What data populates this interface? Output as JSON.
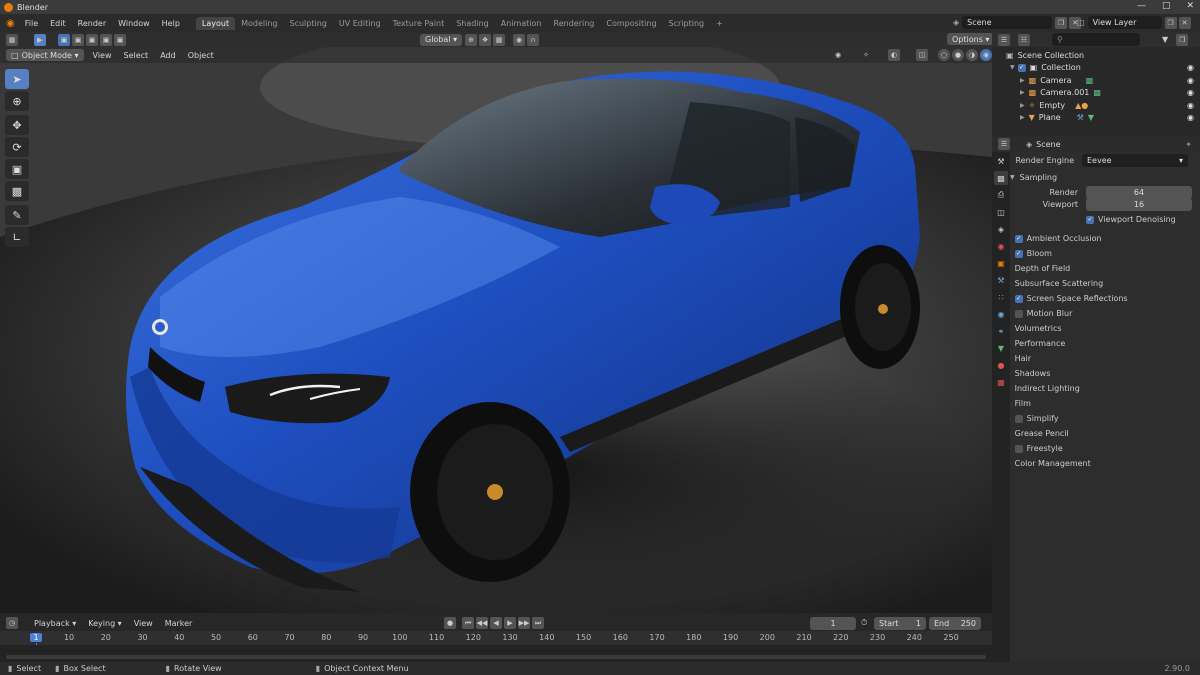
{
  "window": {
    "title": "Blender"
  },
  "menu": [
    "File",
    "Edit",
    "Render",
    "Window",
    "Help"
  ],
  "workspaces": [
    "Layout",
    "Modeling",
    "Sculpting",
    "UV Editing",
    "Texture Paint",
    "Shading",
    "Animation",
    "Rendering",
    "Compositing",
    "Scripting"
  ],
  "active_workspace": "Layout",
  "scene_field": "Scene",
  "view_layer_field": "View Layer",
  "viewport": {
    "transform": "Global",
    "options_label": "Options",
    "mode": "Object Mode",
    "header_menu": [
      "View",
      "Select",
      "Add",
      "Object"
    ]
  },
  "outliner": {
    "title": "Scene Collection",
    "collection": "Collection",
    "items": [
      "Camera",
      "Camera.001",
      "Empty",
      "Plane"
    ]
  },
  "properties": {
    "context": "Scene",
    "render_engine_label": "Render Engine",
    "render_engine_value": "Eevee",
    "sampling_label": "Sampling",
    "render_label": "Render",
    "render_value": "64",
    "viewport_label": "Viewport",
    "viewport_value": "16",
    "viewport_denoising": "Viewport Denoising",
    "sections": [
      {
        "label": "Ambient Occlusion",
        "checkbox": true,
        "checked": true
      },
      {
        "label": "Bloom",
        "checkbox": true,
        "checked": true
      },
      {
        "label": "Depth of Field",
        "checkbox": false
      },
      {
        "label": "Subsurface Scattering",
        "checkbox": false
      },
      {
        "label": "Screen Space Reflections",
        "checkbox": true,
        "checked": true
      },
      {
        "label": "Motion Blur",
        "checkbox": true,
        "checked": false
      },
      {
        "label": "Volumetrics",
        "checkbox": false
      },
      {
        "label": "Performance",
        "checkbox": false
      },
      {
        "label": "Hair",
        "checkbox": false
      },
      {
        "label": "Shadows",
        "checkbox": false
      },
      {
        "label": "Indirect Lighting",
        "checkbox": false
      },
      {
        "label": "Film",
        "checkbox": false
      },
      {
        "label": "Simplify",
        "checkbox": true,
        "checked": false
      },
      {
        "label": "Grease Pencil",
        "checkbox": false
      },
      {
        "label": "Freestyle",
        "checkbox": true,
        "checked": false
      },
      {
        "label": "Color Management",
        "checkbox": false
      }
    ]
  },
  "timeline": {
    "menu": [
      "Playback",
      "Keying",
      "View",
      "Marker"
    ],
    "current_frame": "1",
    "start_label": "Start",
    "start_value": "1",
    "end_label": "End",
    "end_value": "250",
    "ruler": [
      "1",
      "10",
      "20",
      "30",
      "40",
      "50",
      "60",
      "70",
      "80",
      "90",
      "100",
      "110",
      "120",
      "130",
      "140",
      "150",
      "160",
      "170",
      "180",
      "190",
      "200",
      "210",
      "220",
      "230",
      "240",
      "250"
    ]
  },
  "status": {
    "select": "Select",
    "box_select": "Box Select",
    "rotate_view": "Rotate View",
    "context_menu": "Object Context Menu",
    "version": "2.90.0"
  },
  "colors": {
    "accent": "#4772b3",
    "car_blue": "#1f4fbf",
    "active_tool": "#5680c2",
    "playhead": "#4a83d6"
  }
}
